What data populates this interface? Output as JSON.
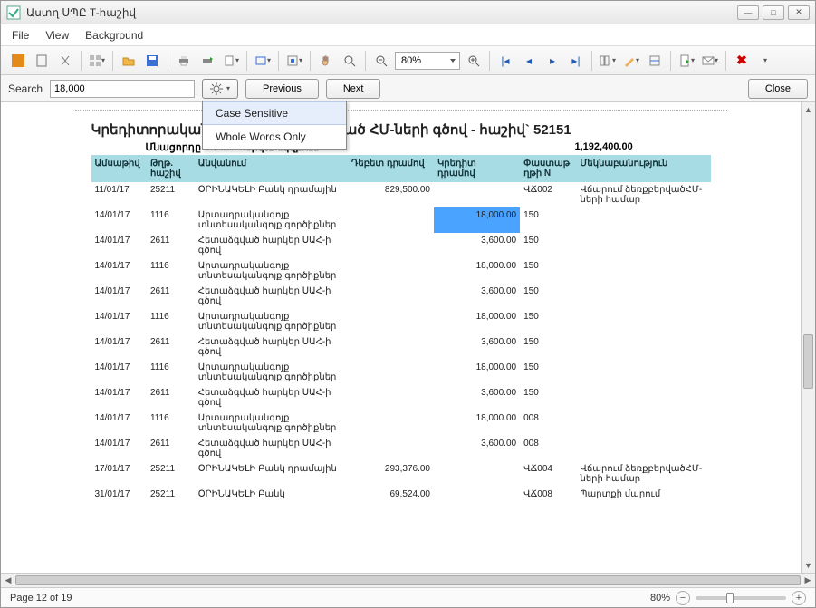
{
  "window": {
    "title": "Աստղ ՍՊԸ T-հաշիվ"
  },
  "menu": {
    "file": "File",
    "view": "View",
    "background": "Background"
  },
  "toolbar": {
    "zoom": "80%"
  },
  "search": {
    "label": "Search",
    "value": "18,000",
    "previous": "Previous",
    "next": "Next",
    "close": "Close",
    "options": {
      "case_sensitive": "Case Sensitive",
      "whole_words": "Whole Words Only"
    }
  },
  "report": {
    "title": "Կրեդիտորական պարտքեր ստացված ՀՄ-ների գծով - հաշիվ` 52151",
    "subtitle_left": "Մնացորդը 01/01/17 օրվա սկզբում",
    "subtitle_right": "1,192,400.00",
    "headers": {
      "date": "Ամսաթիվ",
      "acct": "Թղթ. հաշիվ",
      "name": "Անվանում",
      "debit": "Դեբետ դրամով",
      "credit": "Կրեդիտ դրամով",
      "docn": "Փաստաթ ղթի N",
      "desc": "Մեկնաբանություն"
    },
    "rows": [
      {
        "date": "11/01/17",
        "acct": "25211",
        "name": "ՕՐԻՆԱԿԵԼԻ Բանկ դրամային",
        "debit": "829,500.00",
        "credit": "",
        "doc": "ՎՃ002",
        "desc": "Վճարում ձեռքբերվածՀՄ-ների համար"
      },
      {
        "date": "14/01/17",
        "acct": "1116",
        "name": "Արտադրականգոյք տնտեսականգոյք գործիքներ",
        "debit": "",
        "credit": "18,000.00",
        "doc": "150",
        "desc": "",
        "hl": true
      },
      {
        "date": "14/01/17",
        "acct": "2611",
        "name": "Հետաձգված հարկեր ՍԱՀ-ի գծով",
        "debit": "",
        "credit": "3,600.00",
        "doc": "150",
        "desc": ""
      },
      {
        "date": "14/01/17",
        "acct": "1116",
        "name": "Արտադրականգոյք տնտեսականգոյք գործիքներ",
        "debit": "",
        "credit": "18,000.00",
        "doc": "150",
        "desc": ""
      },
      {
        "date": "14/01/17",
        "acct": "2611",
        "name": "Հետաձգված հարկեր ՍԱՀ-ի գծով",
        "debit": "",
        "credit": "3,600.00",
        "doc": "150",
        "desc": ""
      },
      {
        "date": "14/01/17",
        "acct": "1116",
        "name": "Արտադրականգոյք տնտեսականգոյք գործիքներ",
        "debit": "",
        "credit": "18,000.00",
        "doc": "150",
        "desc": ""
      },
      {
        "date": "14/01/17",
        "acct": "2611",
        "name": "Հետաձգված հարկեր ՍԱՀ-ի գծով",
        "debit": "",
        "credit": "3,600.00",
        "doc": "150",
        "desc": ""
      },
      {
        "date": "14/01/17",
        "acct": "1116",
        "name": "Արտադրականգոյք տնտեսականգոյք գործիքներ",
        "debit": "",
        "credit": "18,000.00",
        "doc": "150",
        "desc": ""
      },
      {
        "date": "14/01/17",
        "acct": "2611",
        "name": "Հետաձգված հարկեր ՍԱՀ-ի գծով",
        "debit": "",
        "credit": "3,600.00",
        "doc": "150",
        "desc": ""
      },
      {
        "date": "14/01/17",
        "acct": "1116",
        "name": "Արտադրականգոյք տնտեսականգոյք գործիքներ",
        "debit": "",
        "credit": "18,000.00",
        "doc": "008",
        "desc": ""
      },
      {
        "date": "14/01/17",
        "acct": "2611",
        "name": "Հետաձգված հարկեր ՍԱՀ-ի գծով",
        "debit": "",
        "credit": "3,600.00",
        "doc": "008",
        "desc": ""
      },
      {
        "date": "17/01/17",
        "acct": "25211",
        "name": "ՕՐԻՆԱԿԵԼԻ Բանկ դրամային",
        "debit": "293,376.00",
        "credit": "",
        "doc": "ՎՃ004",
        "desc": "Վճարում ձեռքբերվածՀՄ-ների համար"
      },
      {
        "date": "31/01/17",
        "acct": "25211",
        "name": "ՕՐԻՆԱԿԵԼԻ Բանկ",
        "debit": "69,524.00",
        "credit": "",
        "doc": "ՎՃ008",
        "desc": "Պարտքի մարում"
      }
    ]
  },
  "status": {
    "page_label": "Page 12 of 19",
    "zoom": "80%"
  }
}
